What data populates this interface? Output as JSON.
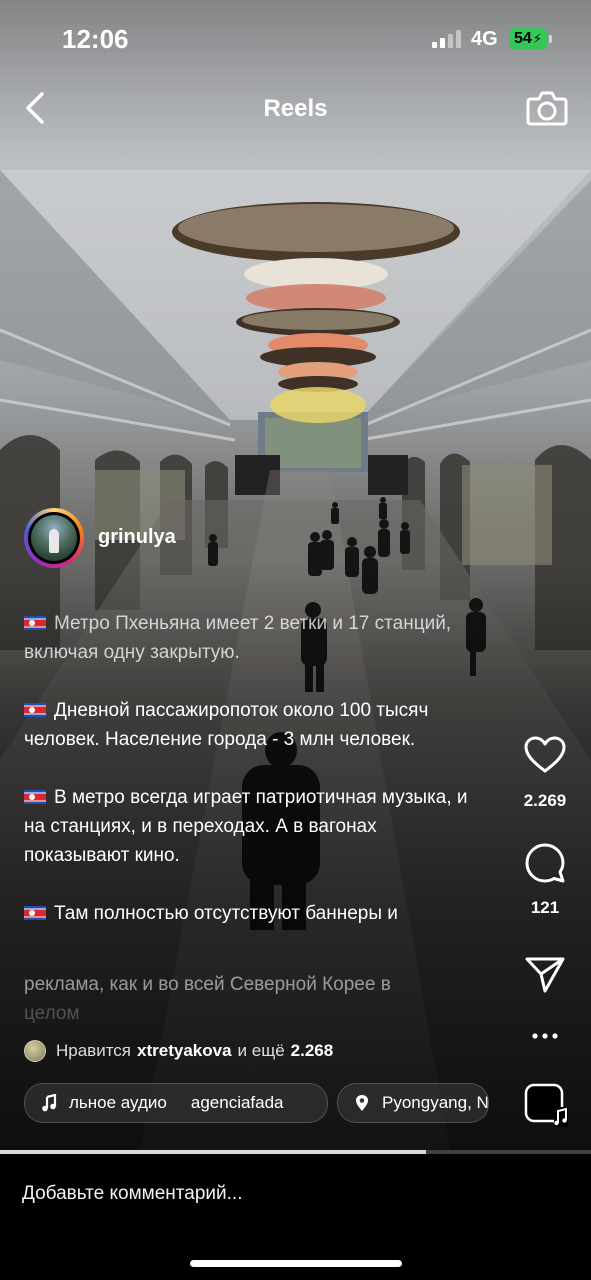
{
  "status_bar": {
    "time": "12:06",
    "network": "4G",
    "battery": "54"
  },
  "header": {
    "title": "Reels"
  },
  "post": {
    "username": "grinulya",
    "caption": [
      "Метро Пхеньяна имеет 2 ветки и 17 станций, включая одну закрытую.",
      "Дневной пассажиропоток около 100 тысяч человек. Население города - 3 млн человек.",
      "В метро всегда играет патриотичная музыка, и на станциях, и в переходах. А в вагонах показывают кино.",
      "Там полностью отсутствуют баннеры и"
    ],
    "caption_tail": [
      "реклама, как и во всей Северной Корее в",
      "целом"
    ],
    "caption_flag_icon": "north-korea-flag-icon"
  },
  "actions": {
    "likes_count": "2.269",
    "comments_count": "121"
  },
  "likes": {
    "prefix": "Нравится",
    "user": "xtretyakova",
    "middle": "и ещё",
    "others": "2.268"
  },
  "audio": {
    "title": "льное аудио",
    "author": "agenciafada"
  },
  "location": {
    "name": "Pyongyang, N"
  },
  "progress": {
    "value": 0.72
  },
  "comment": {
    "placeholder": "Добавьте комментарий..."
  },
  "colors": {
    "battery": "#34c759",
    "background": "#000000"
  }
}
